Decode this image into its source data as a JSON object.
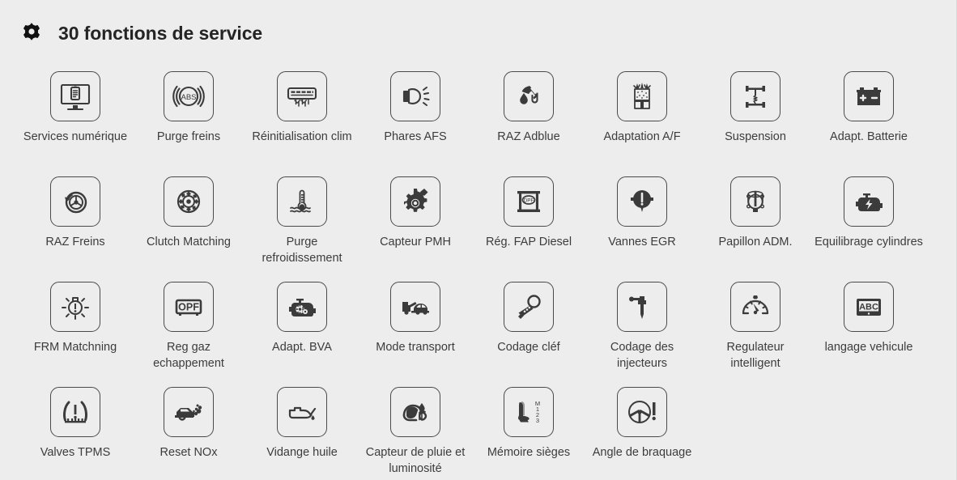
{
  "header": {
    "icon": "gear-icon",
    "title": "30 fonctions de service",
    "count": 30
  },
  "colors": {
    "background": "#ededed",
    "tile_border": "#4a4a4a",
    "icon": "#3b3b3b",
    "label_text": "#3c3c3c",
    "title_text": "#242424"
  },
  "grid": {
    "columns": 8,
    "rows": 4,
    "total_items": 30
  },
  "items": [
    {
      "label": "Services numérique",
      "icon": "monitor-checklist-icon"
    },
    {
      "label": "Purge freins",
      "icon": "abs-brake-icon"
    },
    {
      "label": "Réinitialisation clim",
      "icon": "air-conditioner-icon"
    },
    {
      "label": "Phares AFS",
      "icon": "headlight-icon"
    },
    {
      "label": "RAZ Adblue",
      "icon": "fuel-nozzle-droplet-icon"
    },
    {
      "label": "Adaptation A/F",
      "icon": "air-fuel-injector-icon"
    },
    {
      "label": "Suspension",
      "icon": "chassis-suspension-icon"
    },
    {
      "label": "Adapt. Batterie",
      "icon": "car-battery-icon"
    },
    {
      "label": "RAZ Freins",
      "icon": "brake-wheel-reset-icon"
    },
    {
      "label": "Clutch Matching",
      "icon": "clutch-disc-icon"
    },
    {
      "label": "Purge refroidissement",
      "icon": "coolant-thermometer-icon"
    },
    {
      "label": "Capteur PMH",
      "icon": "crankshaft-sensor-gear-icon"
    },
    {
      "label": "Rég. FAP Diesel",
      "icon": "dpf-filter-icon"
    },
    {
      "label": "Vannes EGR",
      "icon": "egr-valve-icon"
    },
    {
      "label": "Papillon ADM.",
      "icon": "throttle-body-icon"
    },
    {
      "label": "Equilibrage cylindres",
      "icon": "engine-bolt-icon"
    },
    {
      "label": "FRM Matchning",
      "icon": "lamp-warning-icon"
    },
    {
      "label": "Reg gaz echappement",
      "icon": "opf-filter-icon"
    },
    {
      "label": "Adapt. BVA",
      "icon": "gearbox-engine-icon"
    },
    {
      "label": "Mode transport",
      "icon": "car-transport-truck-icon"
    },
    {
      "label": "Codage cléf",
      "icon": "car-key-icon"
    },
    {
      "label": "Codage des injecteurs",
      "icon": "injector-icon"
    },
    {
      "label": "Regulateur intelligent",
      "icon": "cruise-control-gauge-icon"
    },
    {
      "label": "langage vehicule",
      "icon": "abc-screen-icon"
    },
    {
      "label": "Valves TPMS",
      "icon": "tpms-tire-warning-icon"
    },
    {
      "label": "Reset NOx",
      "icon": "car-exhaust-nox-icon"
    },
    {
      "label": "Vidange huile",
      "icon": "oil-can-icon"
    },
    {
      "label": "Capteur de pluie et luminosité",
      "icon": "rain-light-sensor-icon"
    },
    {
      "label": "Mémoire sièges",
      "icon": "seat-memory-icon"
    },
    {
      "label": "Angle de braquage",
      "icon": "steering-angle-icon"
    }
  ]
}
